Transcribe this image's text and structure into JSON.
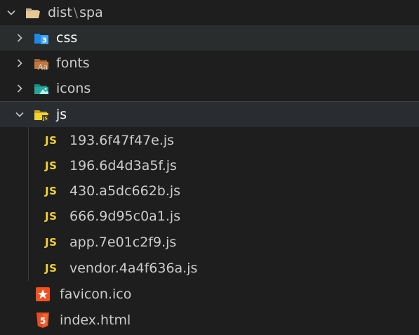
{
  "root": {
    "label": "dist",
    "separator": "\\",
    "sublabel": "spa"
  },
  "folders": [
    {
      "label": "css",
      "icon": "css-folder-icon",
      "color": "#42a5f5"
    },
    {
      "label": "fonts",
      "icon": "fonts-folder-icon",
      "color": "#d08b59"
    },
    {
      "label": "icons",
      "icon": "images-folder-icon",
      "color": "#26a69a"
    },
    {
      "label": "js",
      "icon": "js-folder-icon",
      "color": "#f2d231"
    }
  ],
  "js_files": [
    {
      "badge": "JS",
      "label": "193.6f47f47e.js"
    },
    {
      "badge": "JS",
      "label": "196.6d4d3a5f.js"
    },
    {
      "badge": "JS",
      "label": "430.a5dc662b.js"
    },
    {
      "badge": "JS",
      "label": "666.9d95c0a1.js"
    },
    {
      "badge": "JS",
      "label": "app.7e01c2f9.js"
    },
    {
      "badge": "JS",
      "label": "vendor.4a4f636a.js"
    }
  ],
  "files": [
    {
      "label": "favicon.ico",
      "icon": "star-favicon-icon",
      "color": "#f4511e"
    },
    {
      "label": "index.html",
      "icon": "html5-icon",
      "color": "#e44d26"
    }
  ],
  "font_icon_text": "Aa",
  "html_icon_text": "5",
  "css_icon_text": "3"
}
